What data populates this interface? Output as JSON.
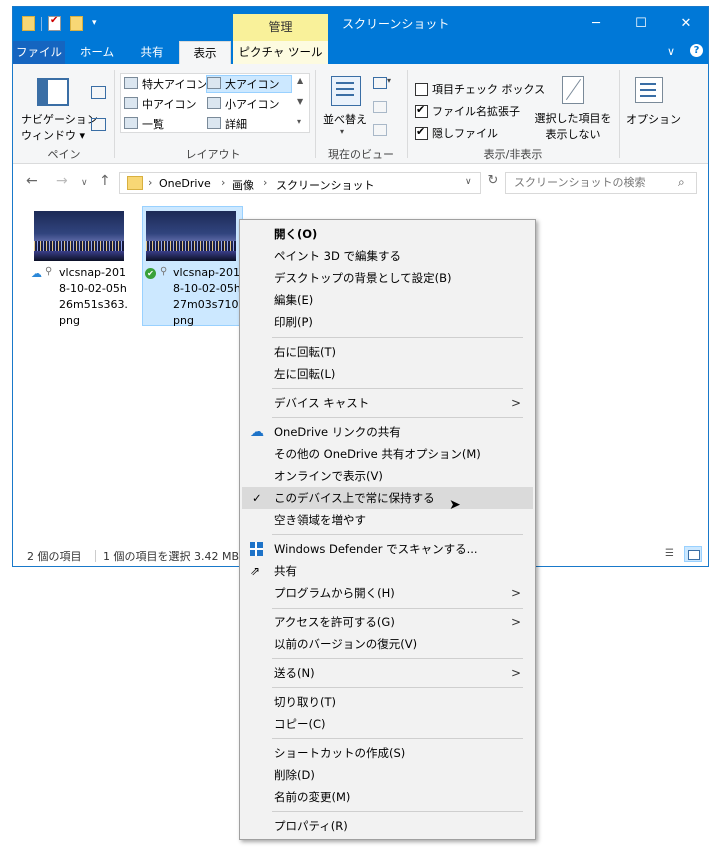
{
  "window": {
    "title": "スクリーンショット",
    "context_tab": "管理",
    "controls": {
      "minimize": "─",
      "maximize": "☐",
      "close": "✕"
    }
  },
  "tabs": [
    "ファイル",
    "ホーム",
    "共有",
    "表示",
    "ピクチャ ツール"
  ],
  "ribbon": {
    "pane": {
      "button": "ナビゲーション\nウィンドウ",
      "label": "ナビゲーション",
      "label2": "ウィンドウ",
      "group": "ペイン"
    },
    "layout": {
      "items": [
        "特大アイコン",
        "大アイコン",
        "中アイコン",
        "小アイコン",
        "一覧",
        "詳細"
      ],
      "selected": "大アイコン",
      "group": "レイアウト"
    },
    "current_view": {
      "sort": "並べ替え",
      "group": "現在のビュー"
    },
    "show_hide": {
      "checkboxes": [
        {
          "label": "項目チェック ボックス",
          "checked": false
        },
        {
          "label": "ファイル名拡張子",
          "checked": true
        },
        {
          "label": "隠しファイル",
          "checked": true
        }
      ],
      "hide_selected_line1": "選択した項目を",
      "hide_selected_line2": "表示しない",
      "group": "表示/非表示"
    },
    "options": "オプション"
  },
  "address": {
    "breadcrumb": [
      "OneDrive",
      "画像",
      "スクリーンショット"
    ],
    "search_placeholder": "スクリーンショットの検索"
  },
  "files": [
    {
      "name_line1": "vlcsnap-201",
      "name_line2": "8-10-02-05h",
      "name_line3": "26m51s363.",
      "name_line4": "png",
      "status_icon": "cloud-icon",
      "selected": false
    },
    {
      "name_line1": "vlcsnap-201",
      "name_line2": "8-10-02-05h",
      "name_line3": "27m03s710.",
      "name_line4": "png",
      "status_icon": "check-circle-icon",
      "selected": true
    }
  ],
  "statusbar": {
    "count": "2 個の項目",
    "selection": "1 個の項目を選択  3.42 MB"
  },
  "context_menu": {
    "items": [
      {
        "label": "開く(O)",
        "bold": true
      },
      {
        "label": "ペイント 3D で編集する"
      },
      {
        "label": "デスクトップの背景として設定(B)"
      },
      {
        "label": "編集(E)"
      },
      {
        "label": "印刷(P)"
      },
      {
        "label": "右に回転(T)"
      },
      {
        "label": "左に回転(L)"
      },
      {
        "label": "デバイス キャスト",
        "submenu": true
      },
      {
        "label": "OneDrive リンクの共有",
        "icon": "onedrive-cloud-icon"
      },
      {
        "label": "その他の OneDrive 共有オプション(M)"
      },
      {
        "label": "オンラインで表示(V)"
      },
      {
        "label": "このデバイス上で常に保持する",
        "checked": true,
        "highlighted": true
      },
      {
        "label": "空き領域を増やす"
      },
      {
        "label": "Windows Defender でスキャンする...",
        "icon": "defender-shield-icon"
      },
      {
        "label": "共有",
        "icon": "share-icon"
      },
      {
        "label": "プログラムから開く(H)",
        "submenu": true
      },
      {
        "label": "アクセスを許可する(G)",
        "submenu": true
      },
      {
        "label": "以前のバージョンの復元(V)"
      },
      {
        "label": "送る(N)",
        "submenu": true
      },
      {
        "label": "切り取り(T)"
      },
      {
        "label": "コピー(C)"
      },
      {
        "label": "ショートカットの作成(S)"
      },
      {
        "label": "削除(D)"
      },
      {
        "label": "名前の変更(M)"
      },
      {
        "label": "プロパティ(R)"
      }
    ]
  },
  "colors": {
    "titlebar": "#0078d7",
    "context_tab": "#f9f19a",
    "selection": "#cce8ff",
    "menu_bg": "#f2f2f2"
  }
}
